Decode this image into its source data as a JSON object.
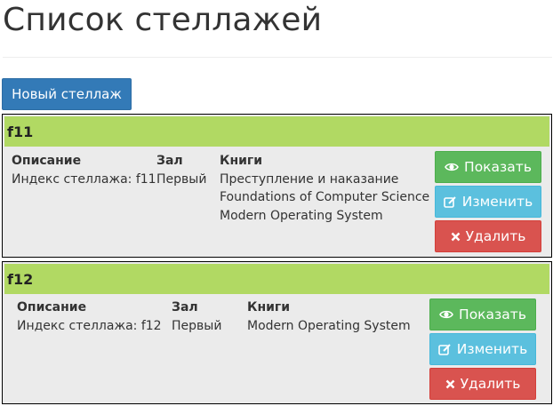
{
  "page": {
    "title": "Список стеллажей",
    "new_button_label": "Новый стеллаж"
  },
  "columns": {
    "description": "Описание",
    "hall": "Зал",
    "books": "Книги"
  },
  "racks": [
    {
      "name": "f11",
      "description": "Индекс стеллажа: f11",
      "hall": "Первый",
      "books": [
        "Преступление и наказание",
        "Foundations of Computer Science",
        "Modern Operating System"
      ]
    },
    {
      "name": "f12",
      "description": "Индекс стеллажа: f12",
      "hall": "Первый",
      "books": [
        "Modern Operating System"
      ]
    }
  ],
  "actions": {
    "show_label": "Показать",
    "edit_label": "Изменить",
    "delete_label": "Удалить",
    "show_icon": "eye-icon",
    "edit_icon": "edit-icon",
    "delete_icon": "close-icon"
  },
  "colors": {
    "primary": "#337ab7",
    "card_header": "#b1d963",
    "card_body": "#ebebeb",
    "show": "#5cb85c",
    "edit": "#5bc0de",
    "delete": "#d9534f"
  }
}
